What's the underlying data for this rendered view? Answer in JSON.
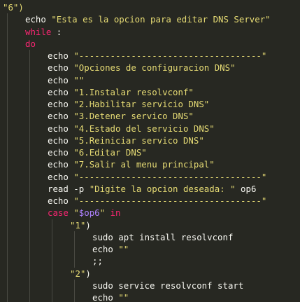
{
  "editor": {
    "theme": {
      "background": "#272822",
      "text": "#f8f8f2",
      "string": "#e6db74",
      "keyword": "#f92672",
      "variable": "#ae81ff",
      "indent_guide": "#4a4a44"
    },
    "lines": [
      {
        "indent": 0,
        "tokens": [
          {
            "c": "str",
            "t": "\"6\")"
          }
        ]
      },
      {
        "indent": 1,
        "tokens": [
          {
            "c": "cmd",
            "t": "echo "
          },
          {
            "c": "str",
            "t": "\"Esta es la opcion para editar DNS Server\""
          }
        ]
      },
      {
        "indent": 1,
        "tokens": [
          {
            "c": "kw",
            "t": "while"
          },
          {
            "c": "op",
            "t": " :"
          }
        ]
      },
      {
        "indent": 1,
        "tokens": [
          {
            "c": "kw",
            "t": "do"
          }
        ]
      },
      {
        "indent": 2,
        "tokens": [
          {
            "c": "cmd",
            "t": "echo "
          },
          {
            "c": "str",
            "t": "\"-----------------------------------\""
          }
        ]
      },
      {
        "indent": 2,
        "tokens": [
          {
            "c": "cmd",
            "t": "echo "
          },
          {
            "c": "str",
            "t": "\"Opciones de configuracion DNS\""
          }
        ]
      },
      {
        "indent": 2,
        "tokens": [
          {
            "c": "cmd",
            "t": "echo "
          },
          {
            "c": "str",
            "t": "\"\""
          }
        ]
      },
      {
        "indent": 2,
        "tokens": [
          {
            "c": "cmd",
            "t": "echo "
          },
          {
            "c": "str",
            "t": "\"1.Instalar resolvconf\""
          }
        ]
      },
      {
        "indent": 2,
        "tokens": [
          {
            "c": "cmd",
            "t": "echo "
          },
          {
            "c": "str",
            "t": "\"2.Habilitar servicio DNS\""
          }
        ]
      },
      {
        "indent": 2,
        "tokens": [
          {
            "c": "cmd",
            "t": "echo "
          },
          {
            "c": "str",
            "t": "\"3.Detener servico DNS\""
          }
        ]
      },
      {
        "indent": 2,
        "tokens": [
          {
            "c": "cmd",
            "t": "echo "
          },
          {
            "c": "str",
            "t": "\"4.Estado del servicio DNS\""
          }
        ]
      },
      {
        "indent": 2,
        "tokens": [
          {
            "c": "cmd",
            "t": "echo "
          },
          {
            "c": "str",
            "t": "\"5.Reiniciar servico DNS\""
          }
        ]
      },
      {
        "indent": 2,
        "tokens": [
          {
            "c": "cmd",
            "t": "echo "
          },
          {
            "c": "str",
            "t": "\"6.Editar DNS\""
          }
        ]
      },
      {
        "indent": 2,
        "tokens": [
          {
            "c": "cmd",
            "t": "echo "
          },
          {
            "c": "str",
            "t": "\"7.Salir al menu principal\""
          }
        ]
      },
      {
        "indent": 2,
        "tokens": [
          {
            "c": "cmd",
            "t": "echo "
          },
          {
            "c": "str",
            "t": "\"-----------------------------------\""
          }
        ]
      },
      {
        "indent": 2,
        "tokens": [
          {
            "c": "cmd",
            "t": "read -p "
          },
          {
            "c": "str",
            "t": "\"Digite la opcion deseada: \""
          },
          {
            "c": "cmd",
            "t": " op6"
          }
        ]
      },
      {
        "indent": 2,
        "tokens": [
          {
            "c": "cmd",
            "t": "echo "
          },
          {
            "c": "str",
            "t": "\"-----------------------------------\""
          }
        ]
      },
      {
        "indent": 2,
        "tokens": [
          {
            "c": "kw",
            "t": "case"
          },
          {
            "c": "op",
            "t": " "
          },
          {
            "c": "str",
            "t": "\""
          },
          {
            "c": "var",
            "t": "$op6"
          },
          {
            "c": "str",
            "t": "\""
          },
          {
            "c": "op",
            "t": " "
          },
          {
            "c": "kw",
            "t": "in"
          }
        ]
      },
      {
        "indent": 3,
        "tokens": [
          {
            "c": "str",
            "t": "\"1\""
          },
          {
            "c": "op",
            "t": ")"
          }
        ]
      },
      {
        "indent": 4,
        "tokens": [
          {
            "c": "cmd",
            "t": "sudo apt install resolvconf"
          }
        ]
      },
      {
        "indent": 4,
        "tokens": [
          {
            "c": "cmd",
            "t": "echo "
          },
          {
            "c": "str",
            "t": "\"\""
          }
        ]
      },
      {
        "indent": 4,
        "tokens": [
          {
            "c": "op",
            "t": ";;"
          }
        ]
      },
      {
        "indent": 3,
        "tokens": [
          {
            "c": "str",
            "t": "\"2\""
          },
          {
            "c": "op",
            "t": ")"
          }
        ]
      },
      {
        "indent": 4,
        "tokens": [
          {
            "c": "cmd",
            "t": "sudo service resolvconf start"
          }
        ]
      },
      {
        "indent": 4,
        "tokens": [
          {
            "c": "cmd",
            "t": "echo "
          },
          {
            "c": "str",
            "t": "\"\""
          }
        ]
      },
      {
        "indent": 4,
        "tokens": [
          {
            "c": "op",
            "t": ";;"
          }
        ]
      }
    ]
  }
}
